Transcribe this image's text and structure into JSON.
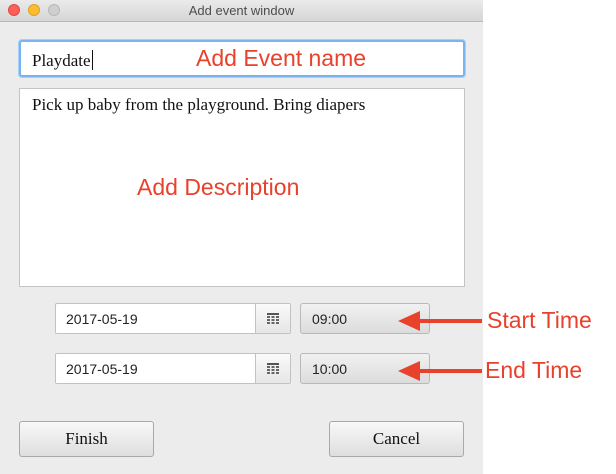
{
  "window": {
    "title": "Add event window"
  },
  "event_name": {
    "value": "Playdate"
  },
  "description": {
    "value": "Pick up baby from the playground. Bring diapers"
  },
  "start": {
    "date": "2017-05-19",
    "time": "09:00"
  },
  "end": {
    "date": "2017-05-19",
    "time": "10:00"
  },
  "buttons": {
    "finish": "Finish",
    "cancel": "Cancel"
  },
  "annotations": {
    "name": "Add Event name",
    "description": "Add Description",
    "start_time": "Start Time",
    "end_time": "End Time"
  },
  "colors": {
    "annotation": "#e8412c",
    "focus_ring": "#79b4f2"
  },
  "icons": {
    "date_picker": "calendar-icon"
  }
}
